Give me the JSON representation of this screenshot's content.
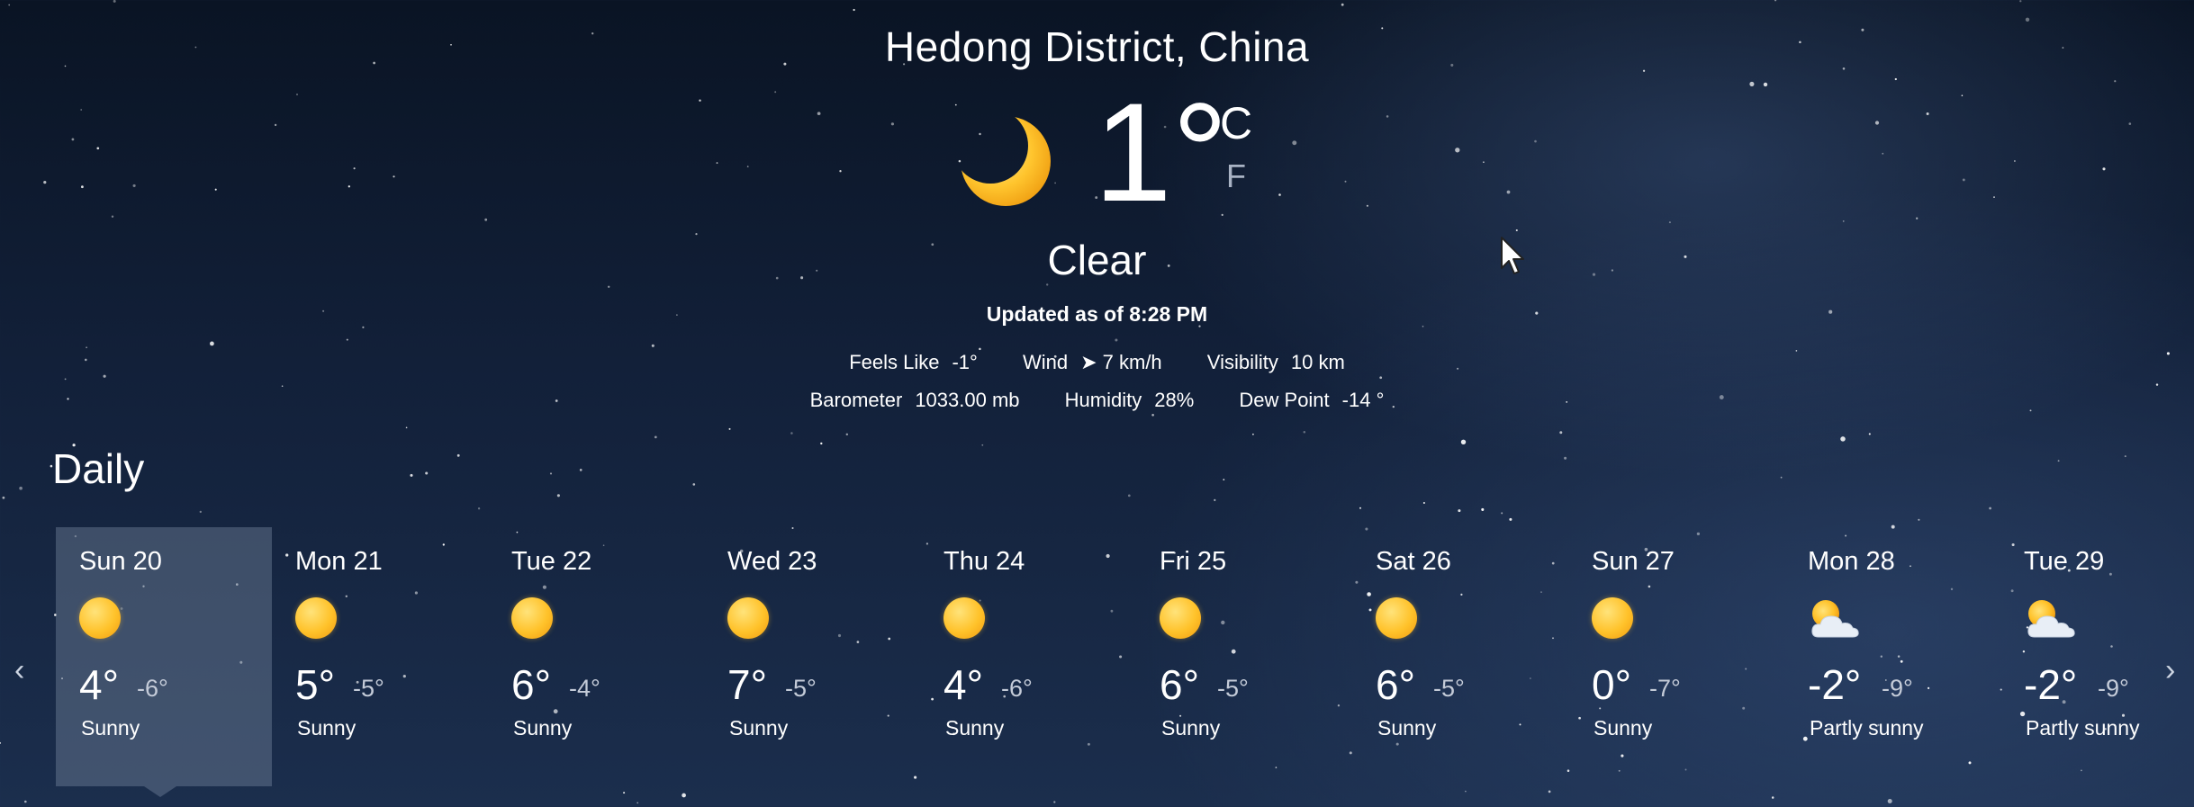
{
  "location": "Hedong District, China",
  "current": {
    "temperature": "1°",
    "unit_celsius": "C",
    "unit_fahrenheit": "F",
    "condition": "Clear",
    "icon": "crescent-moon-icon",
    "updated": "Updated as of 8:28 PM"
  },
  "details": {
    "feels_like_label": "Feels Like",
    "feels_like_value": "-1°",
    "wind_label": "Wind",
    "wind_value": "➤ 7 km/h",
    "visibility_label": "Visibility",
    "visibility_value": "10 km",
    "barometer_label": "Barometer",
    "barometer_value": "1033.00 mb",
    "humidity_label": "Humidity",
    "humidity_value": "28%",
    "dew_point_label": "Dew Point",
    "dew_point_value": "-14 °"
  },
  "daily": {
    "title": "Daily",
    "prev_arrow": "‹",
    "next_arrow": "›",
    "selected_index": 0,
    "days": [
      {
        "label": "Sun 20",
        "hi": "4°",
        "lo": "-6°",
        "desc": "Sunny",
        "icon": "sun-icon"
      },
      {
        "label": "Mon 21",
        "hi": "5°",
        "lo": "-5°",
        "desc": "Sunny",
        "icon": "sun-icon"
      },
      {
        "label": "Tue 22",
        "hi": "6°",
        "lo": "-4°",
        "desc": "Sunny",
        "icon": "sun-icon"
      },
      {
        "label": "Wed 23",
        "hi": "7°",
        "lo": "-5°",
        "desc": "Sunny",
        "icon": "sun-icon"
      },
      {
        "label": "Thu 24",
        "hi": "4°",
        "lo": "-6°",
        "desc": "Sunny",
        "icon": "sun-icon"
      },
      {
        "label": "Fri 25",
        "hi": "6°",
        "lo": "-5°",
        "desc": "Sunny",
        "icon": "sun-icon"
      },
      {
        "label": "Sat 26",
        "hi": "6°",
        "lo": "-5°",
        "desc": "Sunny",
        "icon": "sun-icon"
      },
      {
        "label": "Sun 27",
        "hi": "0°",
        "lo": "-7°",
        "desc": "Sunny",
        "icon": "sun-icon"
      },
      {
        "label": "Mon 28",
        "hi": "-2°",
        "lo": "-9°",
        "desc": "Partly sunny",
        "icon": "partly-sunny-icon"
      },
      {
        "label": "Tue 29",
        "hi": "-2°",
        "lo": "-9°",
        "desc": "Partly sunny",
        "icon": "partly-sunny-icon"
      }
    ]
  }
}
